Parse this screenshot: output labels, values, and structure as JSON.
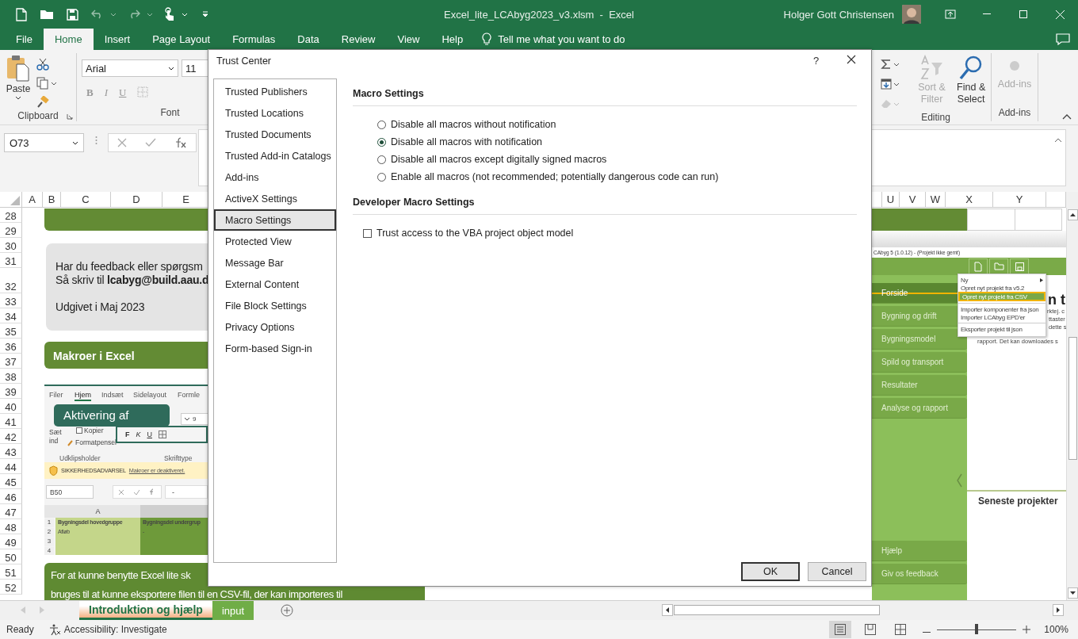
{
  "title_bar": {
    "title": "Excel_lite_LCAbyg2023_v3.xlsm  -  Excel",
    "user": "Holger Gott Christensen"
  },
  "ribbon_tabs": [
    {
      "label": "File",
      "selected": false
    },
    {
      "label": "Home",
      "selected": true
    },
    {
      "label": "Insert",
      "selected": false
    },
    {
      "label": "Page Layout",
      "selected": false
    },
    {
      "label": "Formulas",
      "selected": false
    },
    {
      "label": "Data",
      "selected": false
    },
    {
      "label": "Review",
      "selected": false
    },
    {
      "label": "View",
      "selected": false
    },
    {
      "label": "Help",
      "selected": false
    }
  ],
  "tell_me": "Tell me what you want to do",
  "ribbon": {
    "clipboard": {
      "paste": "Paste",
      "label": "Clipboard"
    },
    "font": {
      "font_name": "Arial",
      "font_size": "11",
      "format_buttons": [
        "B",
        "I",
        "U"
      ],
      "label": "Font"
    },
    "editing": {
      "buttons": [
        {
          "label": "Sort & Filter",
          "disabled": true
        },
        {
          "label": "Find & Select",
          "disabled": false
        }
      ],
      "label": "Editing"
    },
    "add_ins": {
      "button": {
        "label": "Add-ins",
        "disabled": true
      },
      "label": "Add-ins"
    }
  },
  "formula_bar": {
    "name_box": "O73"
  },
  "sheet": {
    "columns_left": [
      "A",
      "B",
      "C",
      "D",
      "E"
    ],
    "columns_right": [
      "U",
      "V",
      "W",
      "X",
      "Y"
    ],
    "rows": [
      "28",
      "29",
      "30",
      "31",
      "32",
      "33",
      "34",
      "35",
      "36",
      "37",
      "38",
      "39",
      "40",
      "41",
      "42",
      "43",
      "44",
      "45",
      "46",
      "47",
      "48",
      "49",
      "50",
      "51",
      "52"
    ],
    "feedback_box": {
      "lines": [
        "Har du feedback eller spørgsm",
        "Så skriv til **lcabyg@build.aau.d**",
        "Udgivet i Maj 2023"
      ]
    },
    "macro_heading": "Makroer i Excel",
    "excel_screenshot": {
      "tabs": [
        {
          "label": "Filer",
          "selected": false
        },
        {
          "label": "Hjem",
          "selected": true
        },
        {
          "label": "Indsæt",
          "selected": false
        },
        {
          "label": "Sidelayout",
          "selected": false
        },
        {
          "label": "Formle",
          "selected": false
        }
      ],
      "callout": "Aktivering af",
      "font_size": "9",
      "paste": "Sæt ind",
      "copy": "Kopier",
      "format_painter": "Formatpensel",
      "format_buttons": [
        "F",
        "K",
        "U"
      ],
      "group_labels": [
        "Udklipsholder",
        "Skrifttype"
      ],
      "warning": "SIKKERHEDSADVARSEL",
      "warning_link": "Makroer er deaktiveret.",
      "name_box": "B50",
      "formula": "-",
      "column": "A",
      "rows": [
        {
          "number": "1",
          "cells": [
            "Bygningsdel hovedgruppe",
            "Bygningsdel undergrup"
          ]
        },
        {
          "number": "2",
          "cells": [
            "Afløb",
            "-"
          ]
        },
        {
          "number": "3"
        },
        {
          "number": "4"
        }
      ]
    },
    "intro_text": [
      "For at kunne benytte Excel lite sk",
      "bruges til at kunne eksportere filen til en CSV-fil, der kan importeres til"
    ],
    "lcabyg_screenshot": {
      "title": "CAbyg 5 (1.0.12) - (Projekt ikke gemt)",
      "nav": [
        {
          "label": "Forside",
          "selected": true
        },
        {
          "label": "Bygning og drift",
          "selected": false
        },
        {
          "label": "Bygningsmodel",
          "selected": false
        },
        {
          "label": "Spild og transport",
          "selected": false
        },
        {
          "label": "Resultater",
          "selected": false
        },
        {
          "label": "Analyse og rapport",
          "selected": false
        }
      ],
      "nav_bottom": [
        "Hjælp",
        "Giv os feedback"
      ],
      "heading": "n t",
      "text_fragments": [
        "rktej. c",
        "ttaster",
        "dette s",
        "rapport. Det kan downloades s"
      ],
      "menu": [
        [
          {
            "label": "Ny",
            "kind": "submenu",
            "selected": false
          },
          {
            "label": "Opret nyt projekt fra v5.2",
            "kind": "item",
            "selected": false
          },
          {
            "label": "Opret nyt projekt fra CSV",
            "kind": "item",
            "selected": true
          }
        ],
        [
          {
            "label": "Importer komponenter fra json",
            "kind": "item",
            "selected": false
          },
          {
            "label": "Importer LCAbyg EPD'er",
            "kind": "item",
            "selected": false
          }
        ],
        [
          {
            "label": "Eksporter projekt til json",
            "kind": "item",
            "selected": false
          }
        ]
      ],
      "recent": "Seneste projekter"
    }
  },
  "dialog": {
    "title": "Trust Center",
    "help": "?",
    "nav": [
      {
        "label": "Trusted Publishers",
        "selected": false
      },
      {
        "label": "Trusted Locations",
        "selected": false
      },
      {
        "label": "Trusted Documents",
        "selected": false
      },
      {
        "label": "Trusted Add-in Catalogs",
        "selected": false
      },
      {
        "label": "Add-ins",
        "selected": false
      },
      {
        "label": "ActiveX Settings",
        "selected": false
      },
      {
        "label": "Macro Settings",
        "selected": true
      },
      {
        "label": "Protected View",
        "selected": false
      },
      {
        "label": "Message Bar",
        "selected": false
      },
      {
        "label": "External Content",
        "selected": false
      },
      {
        "label": "File Block Settings",
        "selected": false
      },
      {
        "label": "Privacy Options",
        "selected": false
      },
      {
        "label": "Form-based Sign-in",
        "selected": false
      }
    ],
    "sections": [
      {
        "heading": "Macro Settings",
        "options": [
          {
            "kind": "radio",
            "label": "Disable all macros without notification",
            "selected": false
          },
          {
            "kind": "radio",
            "label": "Disable all macros with notification",
            "selected": true
          },
          {
            "kind": "radio",
            "label": "Disable all macros except digitally signed macros",
            "selected": false
          },
          {
            "kind": "radio",
            "label": "Enable all macros (not recommended; potentially dangerous code can run)",
            "selected": false
          }
        ]
      },
      {
        "heading": "Developer Macro Settings",
        "options": [
          {
            "kind": "checkbox",
            "label": "Trust access to the VBA project object model",
            "checked": false
          }
        ]
      }
    ],
    "buttons": [
      {
        "label": "OK",
        "default": true
      },
      {
        "label": "Cancel",
        "default": false
      }
    ]
  },
  "sheet_tabs": [
    {
      "label": "Introduktion og hjælp",
      "selected": true,
      "color": "#f4b183"
    },
    {
      "label": "input",
      "selected": false,
      "color": "#70ad47"
    }
  ],
  "status_bar": {
    "status": "Ready",
    "accessibility": "Accessibility: Investigate",
    "zoom_slider": {
      "level": 0.5
    },
    "zoom": "100%"
  }
}
